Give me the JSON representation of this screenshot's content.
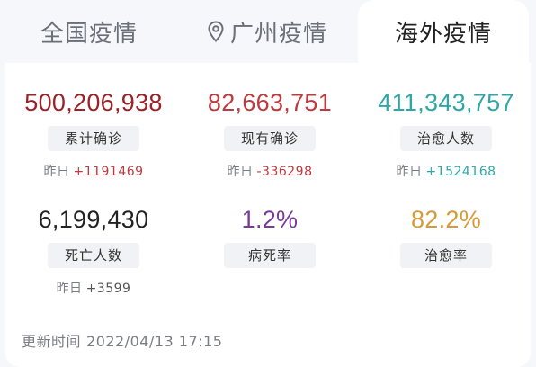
{
  "tabs": [
    {
      "label": "全国疫情",
      "active": false
    },
    {
      "label": "广州疫情",
      "active": false,
      "icon": "location-pin-icon"
    },
    {
      "label": "海外疫情",
      "active": true
    }
  ],
  "metrics": {
    "cumulative_confirmed": {
      "value": "500,206,938",
      "label": "累计确诊",
      "delta_prefix": "昨日",
      "delta": "+1191469",
      "color": "#9b2227",
      "delta_color": "#c0393f"
    },
    "current_confirmed": {
      "value": "82,663,751",
      "label": "现有确诊",
      "delta_prefix": "昨日",
      "delta": "-336298",
      "color": "#c0393f",
      "delta_color": "#c0393f"
    },
    "recovered": {
      "value": "411,343,757",
      "label": "治愈人数",
      "delta_prefix": "昨日",
      "delta": "+1524168",
      "color": "#2fa7a6",
      "delta_color": "#2fa7a6"
    },
    "deaths": {
      "value": "6,199,430",
      "label": "死亡人数",
      "delta_prefix": "昨日",
      "delta": "+3599",
      "color": "#222222",
      "delta_color": "#555555"
    },
    "fatality_rate": {
      "value": "1.2%",
      "label": "病死率",
      "color": "#7a3a9a"
    },
    "recovery_rate": {
      "value": "82.2%",
      "label": "治愈率",
      "color": "#d79a35"
    }
  },
  "update": {
    "label": "更新时间",
    "time": "2022/04/13 17:15"
  }
}
